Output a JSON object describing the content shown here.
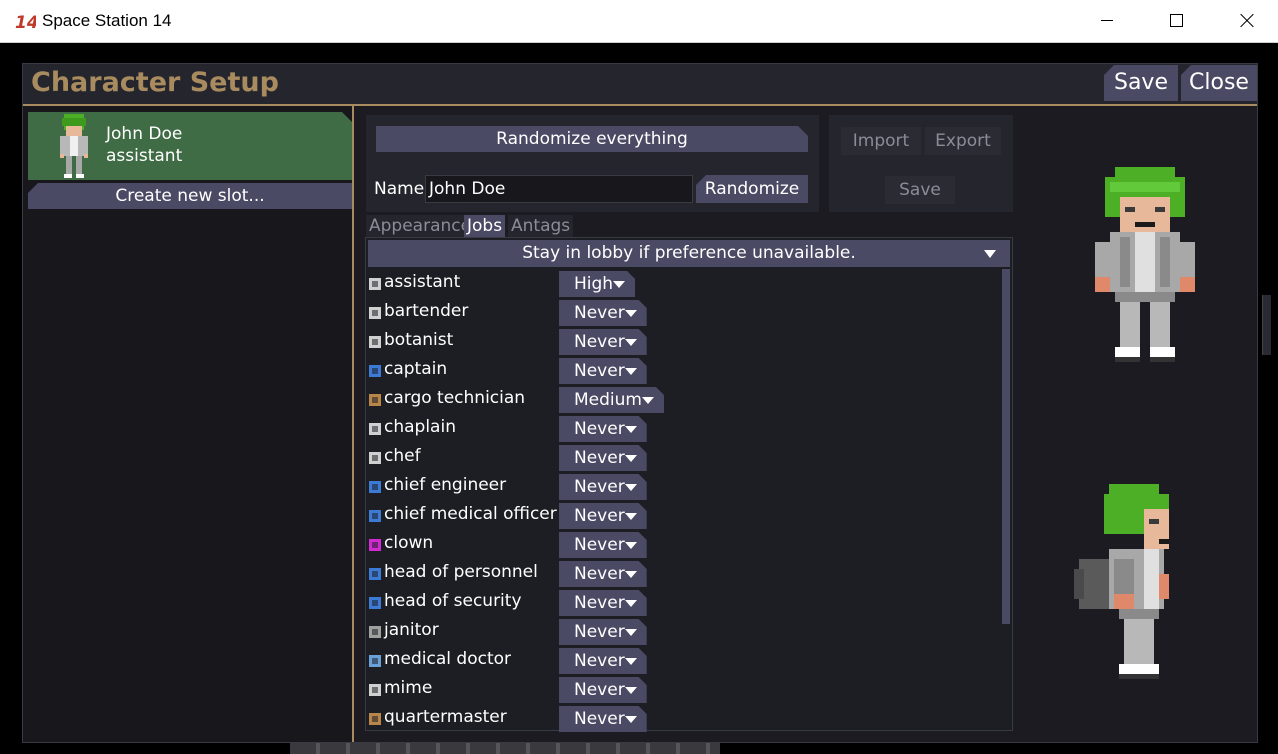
{
  "window": {
    "title": "Space Station 14"
  },
  "panel": {
    "title": "Character Setup",
    "save_label": "Save",
    "close_label": "Close"
  },
  "slots": [
    {
      "name": "John Doe",
      "job": "assistant"
    }
  ],
  "create_slot_label": "Create new slot...",
  "controls": {
    "randomize_everything": "Randomize everything",
    "name_label": "Name:",
    "name_value": "John Doe",
    "randomize_name": "Randomize",
    "import_label": "Import",
    "export_label": "Export",
    "save_label": "Save"
  },
  "tabs": [
    "Appearance",
    "Jobs",
    "Antags"
  ],
  "active_tab": "Jobs",
  "lobby_preference": "Stay in lobby if preference unavailable.",
  "jobs": [
    {
      "name": "assistant",
      "priority": "High",
      "icon_color": "#d0d0d0"
    },
    {
      "name": "bartender",
      "priority": "Never",
      "icon_color": "#d0d0d0"
    },
    {
      "name": "botanist",
      "priority": "Never",
      "icon_color": "#d0d0d0"
    },
    {
      "name": "captain",
      "priority": "Never",
      "icon_color": "#3b7bd6"
    },
    {
      "name": "cargo technician",
      "priority": "Medium",
      "icon_color": "#b8864a"
    },
    {
      "name": "chaplain",
      "priority": "Never",
      "icon_color": "#d0d0d0"
    },
    {
      "name": "chef",
      "priority": "Never",
      "icon_color": "#d0d0d0"
    },
    {
      "name": "chief engineer",
      "priority": "Never",
      "icon_color": "#3b7bd6"
    },
    {
      "name": "chief medical officer",
      "priority": "Never",
      "icon_color": "#3b7bd6"
    },
    {
      "name": "clown",
      "priority": "Never",
      "icon_color": "#d02ad0"
    },
    {
      "name": "head of personnel",
      "priority": "Never",
      "icon_color": "#3b7bd6"
    },
    {
      "name": "head of security",
      "priority": "Never",
      "icon_color": "#3b7bd6"
    },
    {
      "name": "janitor",
      "priority": "Never",
      "icon_color": "#a0a0a0"
    },
    {
      "name": "medical doctor",
      "priority": "Never",
      "icon_color": "#6aa0d8"
    },
    {
      "name": "mime",
      "priority": "Never",
      "icon_color": "#d0d0d0"
    },
    {
      "name": "quartermaster",
      "priority": "Never",
      "icon_color": "#b8864a"
    }
  ],
  "colors": {
    "accent": "#a88b5e",
    "button": "#4a4a64",
    "slot_selected": "#3f6b45",
    "hair": "#4caf25"
  }
}
